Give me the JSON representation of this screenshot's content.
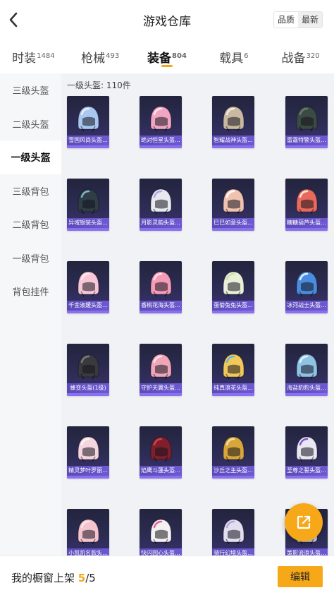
{
  "header": {
    "title": "游戏仓库",
    "sort_quality": "品质",
    "sort_latest": "最新"
  },
  "tabs": [
    {
      "label": "时装",
      "count": "1484"
    },
    {
      "label": "枪械",
      "count": "493"
    },
    {
      "label": "装备",
      "count": "804",
      "active": true
    },
    {
      "label": "载具",
      "count": "6"
    },
    {
      "label": "战备",
      "count": "320"
    }
  ],
  "sidebar": {
    "items": [
      {
        "label": "三级头盔"
      },
      {
        "label": "二级头盔"
      },
      {
        "label": "一级头盔",
        "active": true
      },
      {
        "label": "三级背包"
      },
      {
        "label": "二级背包"
      },
      {
        "label": "一级背包"
      },
      {
        "label": "背包挂件"
      }
    ]
  },
  "content": {
    "count_label": "一级头盔: 110件",
    "items": [
      {
        "name": "雪国风尚头盔...",
        "color": "#a9c7f0",
        "accent": "#e9eef8"
      },
      {
        "name": "绝对恒星头盔...",
        "color": "#f0a6c3",
        "accent": "#fde3ee"
      },
      {
        "name": "智耀战神头盔...",
        "color": "#c9b9a3",
        "accent": "#f3ece3"
      },
      {
        "name": "雷霆特警头盔...",
        "color": "#3c4a44",
        "accent": "#6b7a73"
      },
      {
        "name": "异域银装头盔...",
        "color": "#2e3d46",
        "accent": "#7fb6c9"
      },
      {
        "name": "月影灵韵头盔...",
        "color": "#e8e8ef",
        "accent": "#b9a4e0"
      },
      {
        "name": "巳巳如意头盔...",
        "color": "#f2c2b0",
        "accent": "#ffffff"
      },
      {
        "name": "糖糖葫芦头盔...",
        "color": "#e86a5c",
        "accent": "#fbe8df"
      },
      {
        "name": "千金淑媛头盔...",
        "color": "#f7c7d8",
        "accent": "#fde9f0"
      },
      {
        "name": "香桃花海头盔...",
        "color": "#f59bb6",
        "accent": "#fde2ea"
      },
      {
        "name": "蛋菊兔兔头盔...",
        "color": "#e9efd9",
        "accent": "#cfe0a6"
      },
      {
        "name": "冰河战士头盔...",
        "color": "#4a8de0",
        "accent": "#e6f0fb"
      },
      {
        "name": "蜂变头盔(1级)",
        "color": "#3a3a3e",
        "accent": "#7a7a82"
      },
      {
        "name": "守护天翼头盔...",
        "color": "#f0a6b8",
        "accent": "#fde3ea"
      },
      {
        "name": "纯真浪花头盔...",
        "color": "#f1c95a",
        "accent": "#62b7d8"
      },
      {
        "name": "海盐豹豹头盔...",
        "color": "#8fc3e6",
        "accent": "#e3f1fa"
      },
      {
        "name": "精灵梦叶罗丽...",
        "color": "#f5d6de",
        "accent": "#fff2f5"
      },
      {
        "name": "焰鹰斗篷头盔...",
        "color": "#7e1f2a",
        "accent": "#c94553"
      },
      {
        "name": "沙丘之主头盔...",
        "color": "#d8a63a",
        "accent": "#f3e1a9"
      },
      {
        "name": "至尊之誓头盔...",
        "color": "#e9e6f2",
        "accent": "#7b5cc9"
      },
      {
        "name": "小凯凯名款头...",
        "color": "#f6c4cf",
        "accent": "#fde6eb"
      },
      {
        "name": "快闪园心头盔...",
        "color": "#f5f0f2",
        "accent": "#e8648a"
      },
      {
        "name": "骑行幻境头盔...",
        "color": "#e3def0",
        "accent": "#b6a6df"
      },
      {
        "name": "策影流浪头盔...",
        "color": "#d8d2e8",
        "accent": "#9a88c9"
      }
    ]
  },
  "footer": {
    "label": "我的橱窗上架 ",
    "current": "5",
    "total": "/5",
    "edit_label": "编辑"
  },
  "colors": {
    "accent": "#f6a716",
    "card_bg": "#2d2c55",
    "card_name_bar": "#6e59d2"
  },
  "icons": {
    "back": "chevron-left-icon",
    "share": "share-icon"
  }
}
